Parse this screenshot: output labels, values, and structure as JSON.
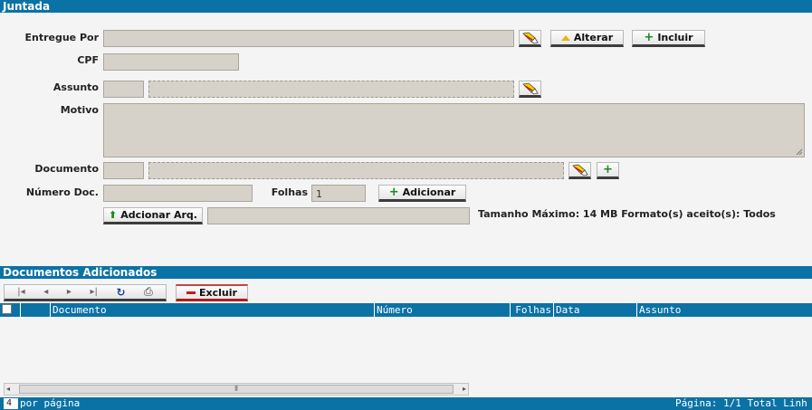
{
  "juntada": {
    "title": "Juntada",
    "labels": {
      "entregue_por": "Entregue Por",
      "cpf": "CPF",
      "assunto": "Assunto",
      "motivo": "Motivo",
      "documento": "Documento",
      "numero_doc": "Número Doc.",
      "folhas": "Folhas"
    },
    "folhas_value": "1",
    "buttons": {
      "alterar": "Alterar",
      "incluir": "Incluir",
      "adicionar": "Adicionar",
      "adicionar_arq": "Adcionar Arq."
    },
    "upload_info": "Tamanho Máximo: 14 MB Formato(s) aceito(s): Todos"
  },
  "documentos": {
    "title": "Documentos Adicionados",
    "excluir": "Excluir",
    "columns": [
      "Documento",
      "Número",
      "Folhas",
      "Data",
      "Assunto"
    ],
    "footer_left_num": "4",
    "footer_left": "por página",
    "footer_right": "Página: 1/1 Total Linh"
  }
}
